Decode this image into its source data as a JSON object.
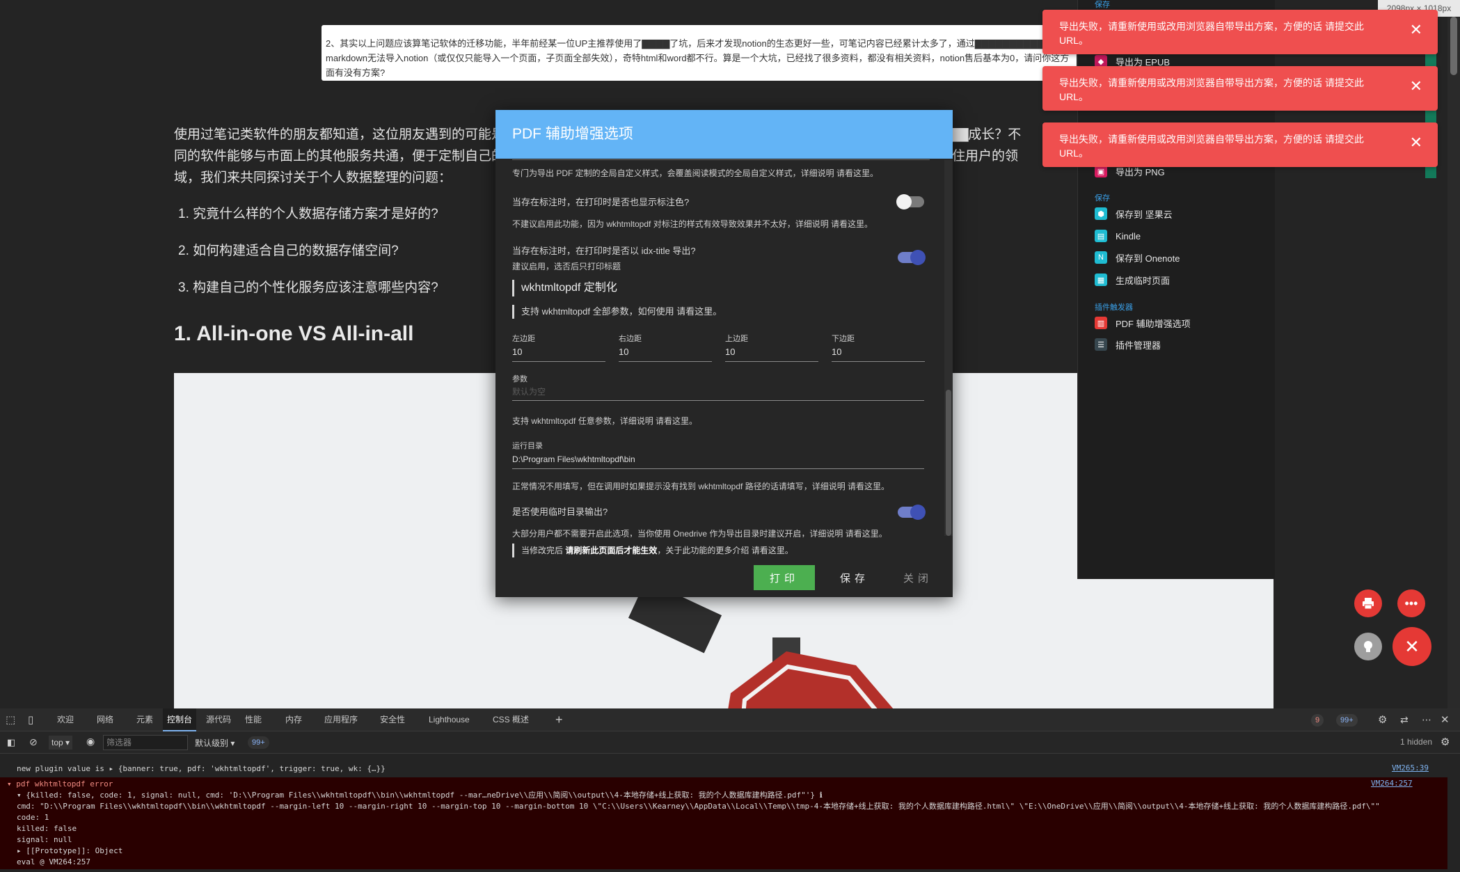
{
  "article": {
    "comment": "2、其实以上问题应该算笔记软体的迁移功能，半年前经某一位UP主推荐使用了▇▇▇▇了坑，后来才发现notion的生态更好一些，可笔记内容已经累计太多了，通过▇▇▇▇▇▇▇▇▇▇▇▇▇ markdown无法导入notion（或仅仅只能导入一个页面，子页面全部失效），奇特html和word都不行。算是一个大坑，已经找了很多资料，都没有相关资料，notion售后基本为0，请问你这方面有没有方案?",
    "paragraph": "使用过笔记类软件的朋友都知道，这位朋友遇到的可能是一个▇▇▇▇▇▇▇▇▇▇▇▇▇▇▇▇▇▇▇▇▇▇▇▇▇▇▇▇▇▇▇▇▇▇▇▇▇▇▇▇▇▇▇成长？不同的软件能够与市面上的其他服务共通，便于定制自己的知识空间；在▇▇▇▇▇▇▇▇▇▇▇▇▇▇▇▇▇▇▇▇▇▇▇▇▇▇▇▇▇▇▇用户且留住用户的领域，我们来共同探讨关于个人数据整理的问题：",
    "list": [
      "1. 究竟什么样的个人数据存储方案才是好的?",
      "2. 如何构建适合自己的数据存储空间?",
      "3. 构建自己的个性化服务应该注意哪些内容?"
    ],
    "heading": "1. All-in-one VS All-in-all"
  },
  "size_tag": "2098px × 1018px",
  "toasts": [
    "导出失败，请重新使用或改用浏览器自带导出方案，方便的话 请提交此URL。",
    "导出失败，请重新使用或改用浏览器自带导出方案，方便的话 请提交此URL。",
    "导出失败，请重新使用或改用浏览器自带导出方案，方便的话 请提交此URL。"
  ],
  "side_panel": {
    "top_section": "保存",
    "export_items": [
      "导出为 EPUB",
      "导出为 PNG"
    ],
    "save_section": "保存",
    "save_items": [
      "保存到 坚果云",
      "Kindle",
      "保存到 Onenote",
      "生成临时页面"
    ],
    "plugin_section": "插件触发器",
    "plugin_items": [
      "PDF 辅助增强选项",
      "插件管理器"
    ]
  },
  "dialog": {
    "title": "PDF 辅助增强选项",
    "intro": "专门为导出 PDF 定制的全局自定义样式，会覆盖阅读模式的全局自定义样式，详细说明 请看这里。",
    "q1": "当存在标注时，在打印时是否也显示标注色?",
    "q1_hint": "不建议启用此功能，因为 wkhtmltopdf 对标注的样式有效导致效果并不太好，详细说明 请看这里。",
    "q2": "当存在标注时，在打印时是否以 idx-title 导出?",
    "q2_hint": "建议启用，选否后只打印标题",
    "section_title": "wkhtmltopdf 定制化",
    "section_hint": "支持 wkhtmltopdf 全部参数，如何使用 请看这里。",
    "margins": [
      {
        "label": "左边距",
        "value": "10"
      },
      {
        "label": "右边距",
        "value": "10"
      },
      {
        "label": "上边距",
        "value": "10"
      },
      {
        "label": "下边距",
        "value": "10"
      }
    ],
    "params_label": "参数",
    "params_placeholder": "默认为空",
    "params_hint": "支持 wkhtmltopdf 任意参数，详细说明 请看这里。",
    "dir_label": "运行目录",
    "dir_value": "D:\\Program Files\\wkhtmltopdf\\bin",
    "dir_hint": "正常情况不用填写，但在调用时如果提示没有找到 wkhtmltopdf 路径的话请填写，详细说明 请看这里。",
    "q3": "是否使用临时目录输出?",
    "q3_hint": "大部分用户都不需要开启此选项，当你使用 Onedrive 作为导出目录时建议开启，详细说明 请看这里。",
    "note_prefix": "当修改完后",
    "note_bold": "请刷新此页面后才能生效",
    "note_suffix": "，关于此功能的更多介绍 请看这里。",
    "toggles": {
      "q1": false,
      "q2": true,
      "q3": true
    },
    "btn_print": "打印",
    "btn_save": "保存",
    "btn_close": "关闭"
  },
  "devtools": {
    "tabs": [
      "欢迎",
      "网络",
      "元素",
      "控制台",
      "源代码",
      "性能",
      "内存",
      "应用程序",
      "安全性",
      "Lighthouse",
      "CSS 概述"
    ],
    "active_tab": "控制台",
    "error_count": "9",
    "info_count": "99+",
    "context": "top",
    "filter_placeholder": "筛选器",
    "level": "默认级别",
    "msg_count": "99+",
    "hidden": "1 hidden",
    "lines": [
      "new plugin value is  ▸ {banner: true, pdf: 'wkhtmltopdf', trigger: true, wk: {…}}",
      "▾ pdf wkhtmltopdf error",
      "  ▾ {killed: false, code: 1, signal: null, cmd: 'D:\\\\Program Files\\\\wkhtmltopdf\\\\bin\\\\wkhtmltopdf --mar…neDrive\\\\应用\\\\简阅\\\\output\\\\4-本地存储+线上获取: 我的个人数据库建构路径.pdf\"'} ℹ",
      "      cmd: \"D:\\\\Program Files\\\\wkhtmltopdf\\\\bin\\\\wkhtmltopdf --margin-left 10 --margin-right 10 --margin-top 10 --margin-bottom 10 \\\"C:\\\\Users\\\\Kearney\\\\AppData\\\\Local\\\\Temp\\\\tmp-4-本地存储+线上获取: 我的个人数据库建构路径.html\\\" \\\"E:\\\\OneDrive\\\\应用\\\\简阅\\\\output\\\\4-本地存储+线上获取: 我的个人数据库建构路径.pdf\\\"\"",
      "      code: 1",
      "      killed: false",
      "      signal: null",
      "    ▸ [[Prototype]]: Object",
      "  eval @ VM264:257"
    ],
    "links": [
      "VM265:39",
      "VM264:257"
    ]
  }
}
